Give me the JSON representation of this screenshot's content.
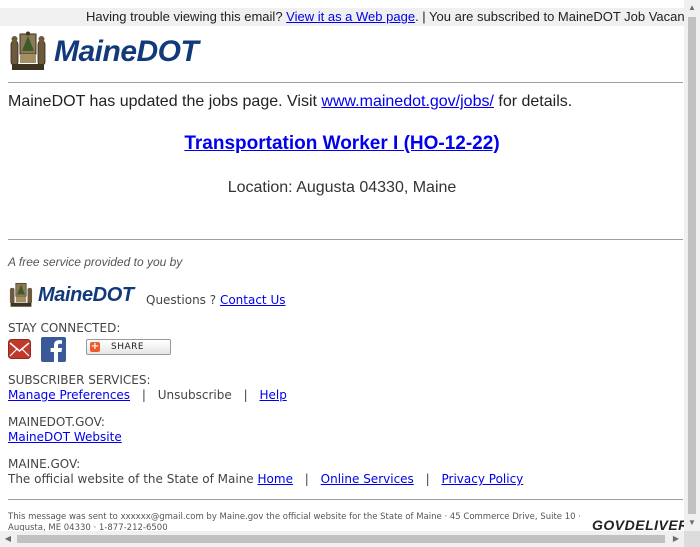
{
  "topbar": {
    "prefix": "Having trouble viewing this email?",
    "web_link": "View it as a Web page",
    "suffix": ". | You are subscribed to MaineDOT Job Vacancies"
  },
  "header": {
    "brand": "MaineDOT"
  },
  "intro": {
    "text": "MaineDOT has updated the jobs page. Visit",
    "link": "www.mainedot.gov/jobs/",
    "suffix": "for details."
  },
  "job": {
    "title": "Transportation Worker I (HO-12-22)",
    "location": "Location: Augusta 04330, Maine"
  },
  "footer": {
    "free_service": "A free service provided to you by",
    "brand": "MaineDOT",
    "questions": "Questions ?",
    "contact_link": "Contact Us",
    "stay_connected": "STAY CONNECTED:",
    "share_label": "SHARE",
    "subscriber_services": "SUBSCRIBER SERVICES:",
    "manage_preferences": "Manage Preferences",
    "unsubscribe": "Unsubscribe",
    "help": "Help",
    "mainedot_gov": "MAINEDOT.GOV:",
    "mainedot_website": "MaineDOT Website",
    "maine_gov": "MAINE.GOV:",
    "official_site_text": "The official website of the State of Maine",
    "home": "Home",
    "online_services": "Online Services",
    "privacy_policy": "Privacy Policy",
    "sep": "|",
    "small_print": "This message was sent to xxxxxx@gmail.com by Maine.gov the official website for the State of Maine · 45 Commerce Drive, Suite 10 · Augusta, ME 04330 · 1-877-212-6500",
    "govdelivery": "GOVDELIVERY"
  },
  "colors": {
    "brand_blue": "#123a7a",
    "link": "#0000ee",
    "share_orange": "#f05a28",
    "facebook_blue": "#3b5998",
    "email_red": "#c0392b"
  }
}
